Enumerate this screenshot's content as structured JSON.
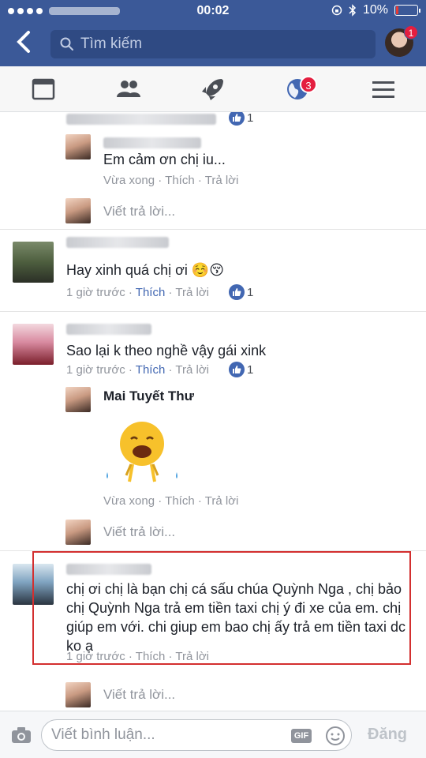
{
  "status_bar": {
    "time": "00:02",
    "battery": "10%"
  },
  "header": {
    "search_placeholder": "Tìm kiếm",
    "profile_badge": "1",
    "notifications_badge": "3"
  },
  "comments": [
    {
      "reply": {
        "text": "Em cảm ơn chị iu...",
        "time": "Vừa xong",
        "like": "Thích",
        "reply": "Trả lời"
      },
      "parent_likes": "1",
      "write_reply": "Viết trả lời..."
    },
    {
      "text": "Hay xinh quá chị ơi ☺️😚",
      "time": "1 giờ trước",
      "like": "Thích",
      "reply": "Trả lời",
      "likes": "1"
    },
    {
      "text": "Sao lại k theo nghề vậy gái xink",
      "time": "1 giờ trước",
      "like": "Thích",
      "reply": "Trả lời",
      "likes": "1",
      "reply_item": {
        "name": "Mai Tuyết Thư",
        "time": "Vừa xong",
        "like": "Thích",
        "reply": "Trả lời"
      },
      "write_reply": "Viết trả lời..."
    },
    {
      "text": "chị ơi chị là bạn chị  cá sấu chúa Quỳnh Nga , chị bảo chị Quỳnh Nga trả em tiền taxi chị ý đi xe của em. chị giúp em với. chi giup em bao chị ấy trả em tiền taxi dc ko ạ",
      "time": "1 giờ trước",
      "like": "Thích",
      "reply": "Trả lời",
      "write_reply": "Viết trả lời..."
    }
  ],
  "composer": {
    "placeholder": "Viết bình luận...",
    "gif": "GIF",
    "post": "Đăng"
  },
  "colors": {
    "brand": "#3b5998",
    "link": "#4267b2",
    "highlight": "#d32f2f"
  }
}
